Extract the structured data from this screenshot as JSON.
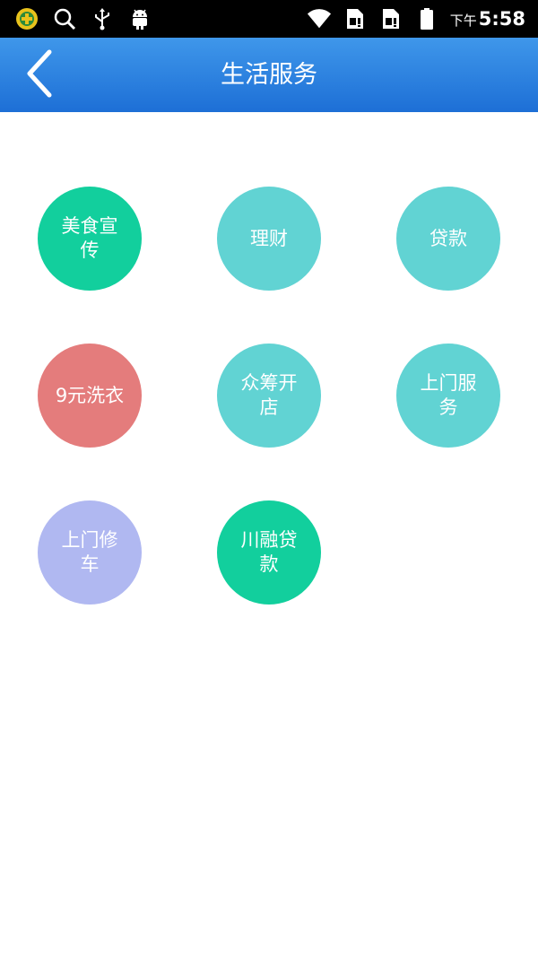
{
  "status_bar": {
    "ampm": "下午",
    "time": "5:58",
    "icons": [
      "app-logo-icon",
      "search-icon",
      "usb-icon",
      "android-icon",
      "wifi-icon",
      "sim-card-1-icon",
      "sim-card-2-icon",
      "battery-icon"
    ]
  },
  "header": {
    "title": "生活服务",
    "back_icon": "chevron-left-icon",
    "background_color": "#2a80e0"
  },
  "services": [
    {
      "label": "美食宣传",
      "color": "#12cf9d"
    },
    {
      "label": "理财",
      "color": "#61d3d3"
    },
    {
      "label": "贷款",
      "color": "#61d3d3"
    },
    {
      "label": "9元洗衣",
      "color": "#e47c7c"
    },
    {
      "label": "众筹开店",
      "color": "#61d3d3"
    },
    {
      "label": "上门服务",
      "color": "#61d3d3"
    },
    {
      "label": "上门修车",
      "color": "#b0b8f1"
    },
    {
      "label": "川融贷款",
      "color": "#12cf9d"
    }
  ]
}
